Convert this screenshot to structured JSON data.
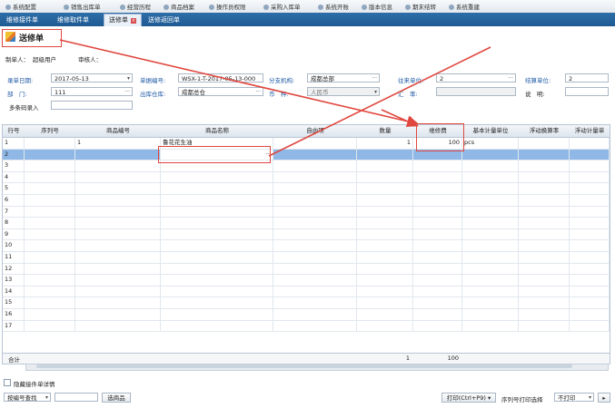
{
  "menu": [
    "系统配置",
    "销售出库单",
    "经营历程",
    "商品档案",
    "操作员权限",
    "采购入库单",
    "系统开账",
    "版本信息",
    "期末结转",
    "系统重建"
  ],
  "tabs": [
    "维修接件单",
    "维修取件单",
    "送修单",
    "送修返回单"
  ],
  "title": "送修单",
  "header": {
    "maker_label": "制单人：",
    "maker_value": "超级用户",
    "auditor_label": "审核人：",
    "date_label": "录单日期:",
    "date_value": "2017-05-13",
    "docno_label": "单据编号:",
    "docno_value": "WSX-1-T-2017-05-13-000",
    "branch_label": "分支机构:",
    "branch_value": "成都总部",
    "supplier_label": "往来单位:",
    "supplier_value": "2",
    "settle_label": "结算单位:",
    "settle_value": "2",
    "dept_label": "部　门:",
    "dept_value": "111",
    "warehouse_label": "出库仓库:",
    "warehouse_value": "成都总仓",
    "currency_label": "币　种:",
    "currency_value": "人民币",
    "rate_label": "汇　率:",
    "note_label": "说　明:",
    "barcode_label": "多条码录入"
  },
  "grid": {
    "columns": [
      "行号",
      "序列号",
      "商品编号",
      "商品名称",
      "自由项",
      "数量",
      "维修费",
      "基本计量单位",
      "浮动换算率",
      "浮动计量单"
    ],
    "rows": [
      {
        "no": "1",
        "serial": "",
        "code": "1",
        "name": "鲁花花生油",
        "free": "",
        "qty": "1",
        "fee": "100",
        "unit": "pcs"
      },
      {
        "no": "2",
        "serial": "",
        "code": "",
        "name": "",
        "free": "",
        "qty": "",
        "fee": "",
        "unit": ""
      },
      {
        "no": "3"
      },
      {
        "no": "4"
      },
      {
        "no": "5"
      },
      {
        "no": "6"
      },
      {
        "no": "7"
      },
      {
        "no": "8"
      },
      {
        "no": "9"
      },
      {
        "no": "10"
      },
      {
        "no": "11"
      },
      {
        "no": "12"
      },
      {
        "no": "13"
      },
      {
        "no": "14"
      },
      {
        "no": "15"
      },
      {
        "no": "16"
      },
      {
        "no": "17"
      }
    ],
    "footer": {
      "label": "合计",
      "qty": "1",
      "fee": "100"
    }
  },
  "bottom": {
    "hide_detail": "隐藏接件单详情",
    "search_mode": "按编号查找",
    "select_goods": "选商品",
    "print": "打印(Ctrl+P9)",
    "serial_print_label": "序列号打印选择",
    "serial_print_value": "不打印"
  },
  "colors": {
    "accent": "#2a6aa5",
    "highlight": "#e0473f",
    "selected_row": "#8fb8e6"
  }
}
